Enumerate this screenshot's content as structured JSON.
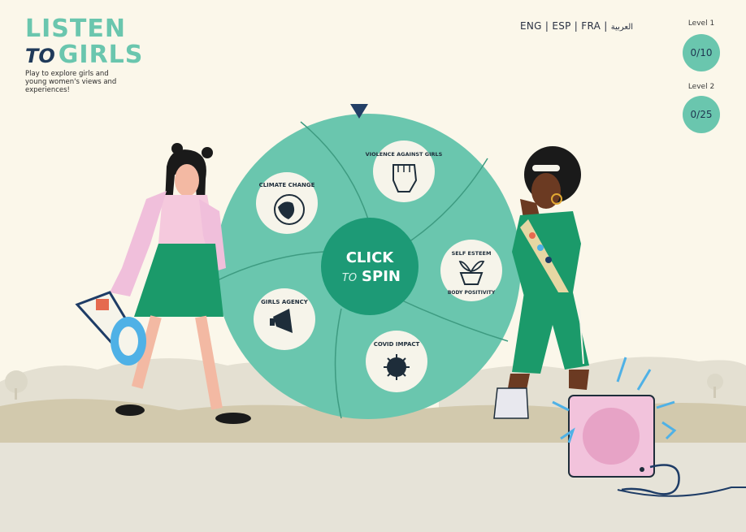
{
  "logo": {
    "line1": "LISTEN",
    "to": "TO",
    "girls": "GIRLS"
  },
  "tagline": "Play to explore girls and young women's views and experiences!",
  "languages": {
    "eng": "ENG",
    "esp": "ESP",
    "fra": "FRA",
    "ara": "العربية",
    "sep": " | "
  },
  "levels": [
    {
      "label": "Level 1",
      "progress": "0/10"
    },
    {
      "label": "Level 2",
      "progress": "0/25"
    }
  ],
  "wheel": {
    "center_line1": "CLICK",
    "center_to": "TO",
    "center_line2": "SPIN",
    "segments": [
      {
        "label": "CLIMATE CHANGE",
        "icon": "globe-icon"
      },
      {
        "label": "VIOLENCE AGAINST GIRLS",
        "icon": "fist-icon"
      },
      {
        "label": "SELF ESTEEM",
        "label2": "BODY POSITIVITY",
        "icon": "plant-icon"
      },
      {
        "label": "COVID IMPACT",
        "icon": "virus-icon"
      },
      {
        "label": "GIRLS AGENCY",
        "icon": "megaphone-icon"
      }
    ]
  },
  "colors": {
    "wheel": "#6ac6ae",
    "wheel_dark": "#2a9d7a",
    "navy": "#1f3a5a",
    "bg": "#fbf7ea"
  }
}
